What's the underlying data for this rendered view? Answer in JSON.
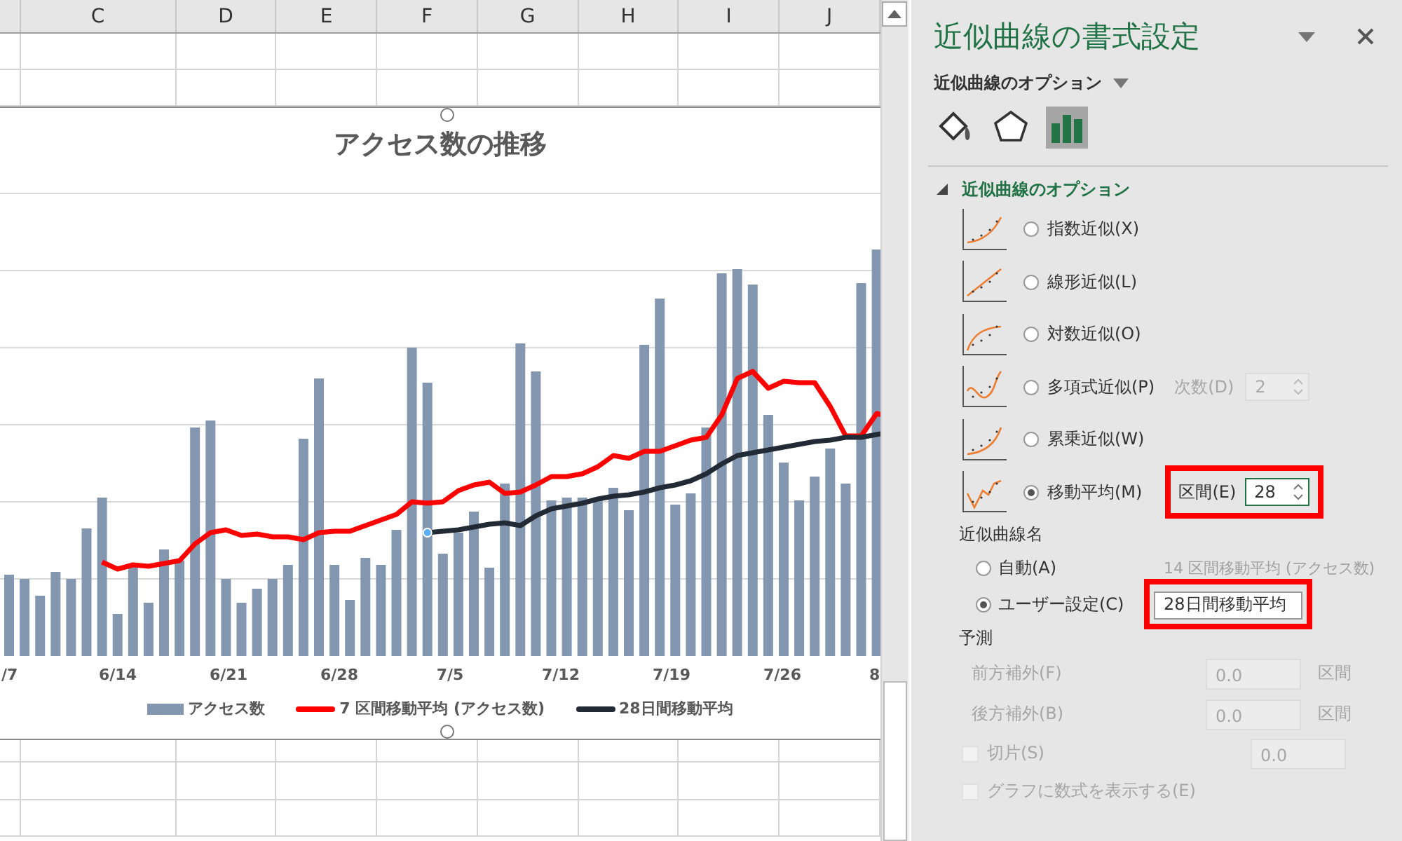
{
  "sheet": {
    "columns": [
      "C",
      "D",
      "E",
      "F",
      "G",
      "H",
      "I",
      "J"
    ]
  },
  "chart": {
    "title": "アクセス数の推移",
    "selected": true,
    "x_labels": [
      "/7",
      "6/14",
      "6/21",
      "6/28",
      "7/5",
      "7/12",
      "7/19",
      "7/26",
      "8"
    ],
    "legend": [
      {
        "label": "アクセス数",
        "kind": "bar",
        "color": "#8497b0"
      },
      {
        "label": "7 区間移動平均 (アクセス数)",
        "kind": "line",
        "color": "#ff0000"
      },
      {
        "label": "28日間移動平均",
        "kind": "line",
        "color": "#222a35"
      }
    ]
  },
  "pane": {
    "title": "近似曲線の書式設定",
    "menu": "近似曲線のオプション",
    "tabs": [
      {
        "kind": "fill",
        "selected": false
      },
      {
        "kind": "effects",
        "selected": false
      },
      {
        "kind": "options",
        "selected": true
      }
    ],
    "section": {
      "title": "近似曲線のオプション",
      "expanded": true
    },
    "types": [
      {
        "label": "指数近似(X)",
        "kind": "exponential",
        "selected": false
      },
      {
        "label": "線形近似(L)",
        "kind": "linear",
        "selected": false
      },
      {
        "label": "対数近似(O)",
        "kind": "logarithmic",
        "selected": false
      },
      {
        "label": "多項式近似(P)",
        "kind": "polynomial",
        "selected": false,
        "order": {
          "label": "次数(D)",
          "value": "2",
          "disabled": true
        }
      },
      {
        "label": "累乗近似(W)",
        "kind": "power",
        "selected": false
      },
      {
        "label": "移動平均(M)",
        "kind": "moving",
        "selected": true,
        "period": {
          "label": "区間(E)",
          "value": "28",
          "highlighted": true
        }
      }
    ],
    "name": {
      "title": "近似曲線名",
      "options": [
        {
          "label": "自動(A)",
          "kind": "auto",
          "selected": false,
          "value": "14 区間移動平均 (アクセス数)"
        },
        {
          "label": "ユーザー設定(C)",
          "kind": "custom",
          "selected": true,
          "value": "28日間移動平均",
          "highlighted": true
        }
      ]
    },
    "forecast": {
      "title": "予測",
      "rows": [
        {
          "label": "前方補外(F)",
          "value": "0.0",
          "unit": "区間",
          "disabled": true
        },
        {
          "label": "後方補外(B)",
          "value": "0.0",
          "unit": "区間",
          "disabled": true
        }
      ]
    },
    "intercept": {
      "label": "切片(S)",
      "checked": false,
      "value": "0.0",
      "disabled": true
    },
    "show_equation": {
      "label": "グラフに数式を表示する(E)",
      "checked": false,
      "disabled": true
    }
  }
}
